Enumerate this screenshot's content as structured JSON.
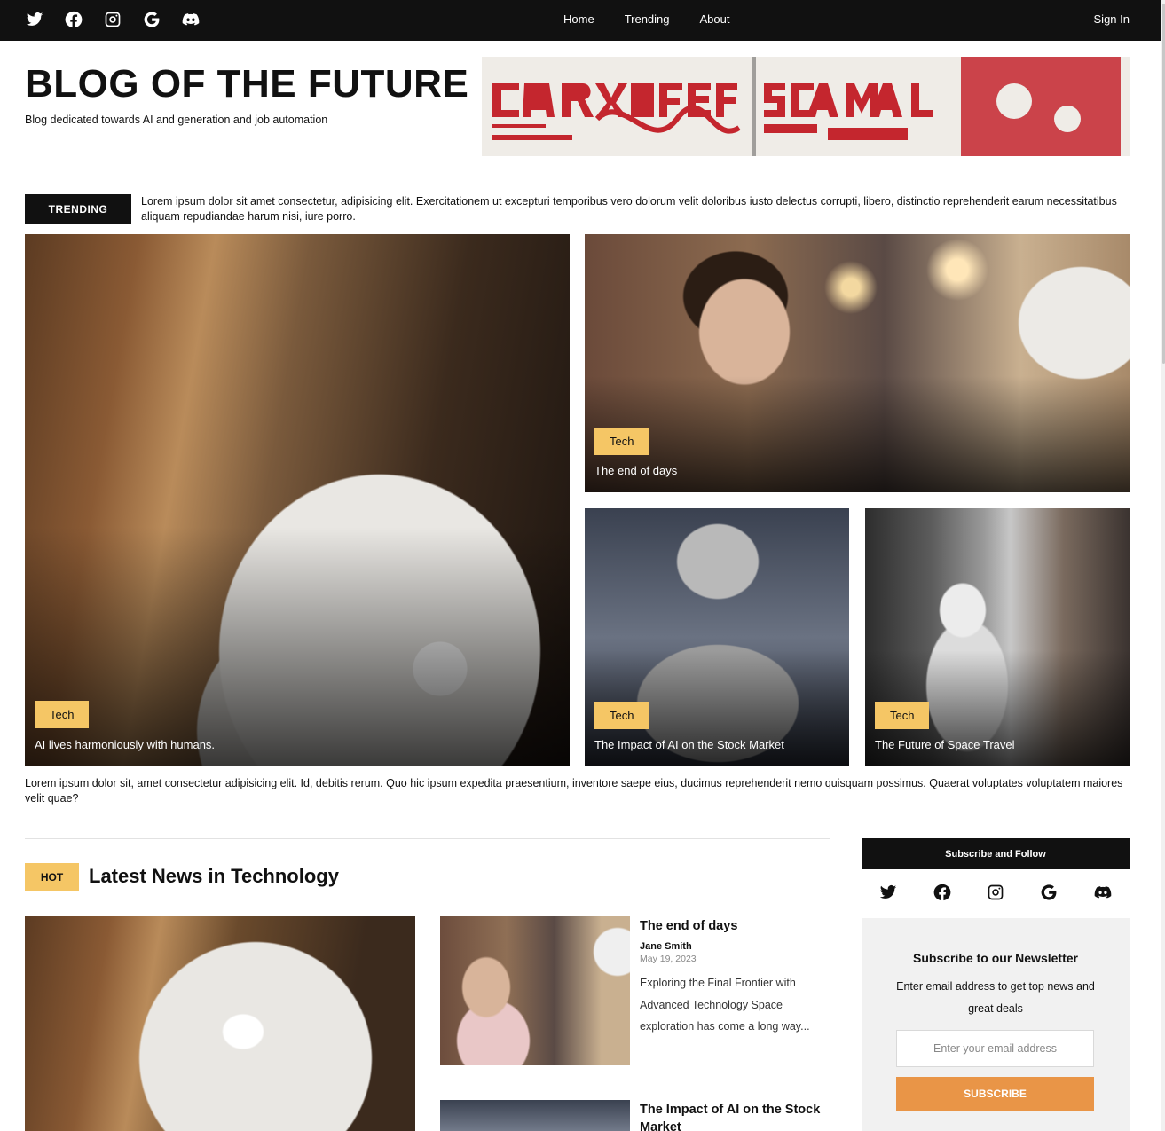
{
  "topbar": {
    "social_icons": [
      "twitter-icon",
      "facebook-icon",
      "instagram-icon",
      "google-icon",
      "discord-icon"
    ],
    "nav": [
      "Home",
      "Trending",
      "About"
    ],
    "sign_in": "Sign In"
  },
  "header": {
    "title": "BLOG OF THE FUTURE",
    "subtitle": "Blog dedicated towards AI and generation and job automation"
  },
  "trending": {
    "label": "TRENDING",
    "text": "Lorem ipsum dolor sit amet consectetur, adipisicing elit. Exercitationem ut excepturi temporibus vero dolorum velit doloribus iusto delectus corrupti, libero, distinctio reprehenderit earum necessitatibus aliquam repudiandae harum nisi, iure porro."
  },
  "features": [
    {
      "tag": "Tech",
      "caption": "AI lives harmoniously with humans."
    },
    {
      "tag": "Tech",
      "caption": "The end of days"
    },
    {
      "tag": "Tech",
      "caption": "The Impact of AI on the Stock Market"
    },
    {
      "tag": "Tech",
      "caption": "The Future of Space Travel"
    }
  ],
  "blurb": "Lorem ipsum dolor sit, amet consectetur adipisicing elit. Id, debitis rerum. Quo hic ipsum expedita praesentium, inventore saepe eius, ducimus reprehenderit nemo quisquam possimus. Quaerat voluptates voluptatem maiores velit quae?",
  "latest": {
    "badge": "HOT",
    "title": "Latest News in Technology",
    "articles": [
      {
        "title": "The end of days",
        "author": "Jane Smith",
        "date": "May 19, 2023",
        "excerpt": "Exploring the Final Frontier with Advanced Technology Space exploration has come a long way..."
      },
      {
        "title": "The Impact of AI on the Stock Market"
      }
    ]
  },
  "sidebar": {
    "heading": "Subscribe and Follow",
    "social_icons": [
      "twitter-icon",
      "facebook-icon",
      "instagram-icon",
      "google-icon",
      "discord-icon"
    ],
    "newsletter": {
      "title": "Subscribe to our Newsletter",
      "description": "Enter email address to get top news and great deals",
      "email_placeholder": "Enter your email address",
      "button": "SUBSCRIBE"
    }
  },
  "colors": {
    "topbar": "#111111",
    "tag_yellow": "#f5c665",
    "subscribe_orange": "#e99547"
  }
}
